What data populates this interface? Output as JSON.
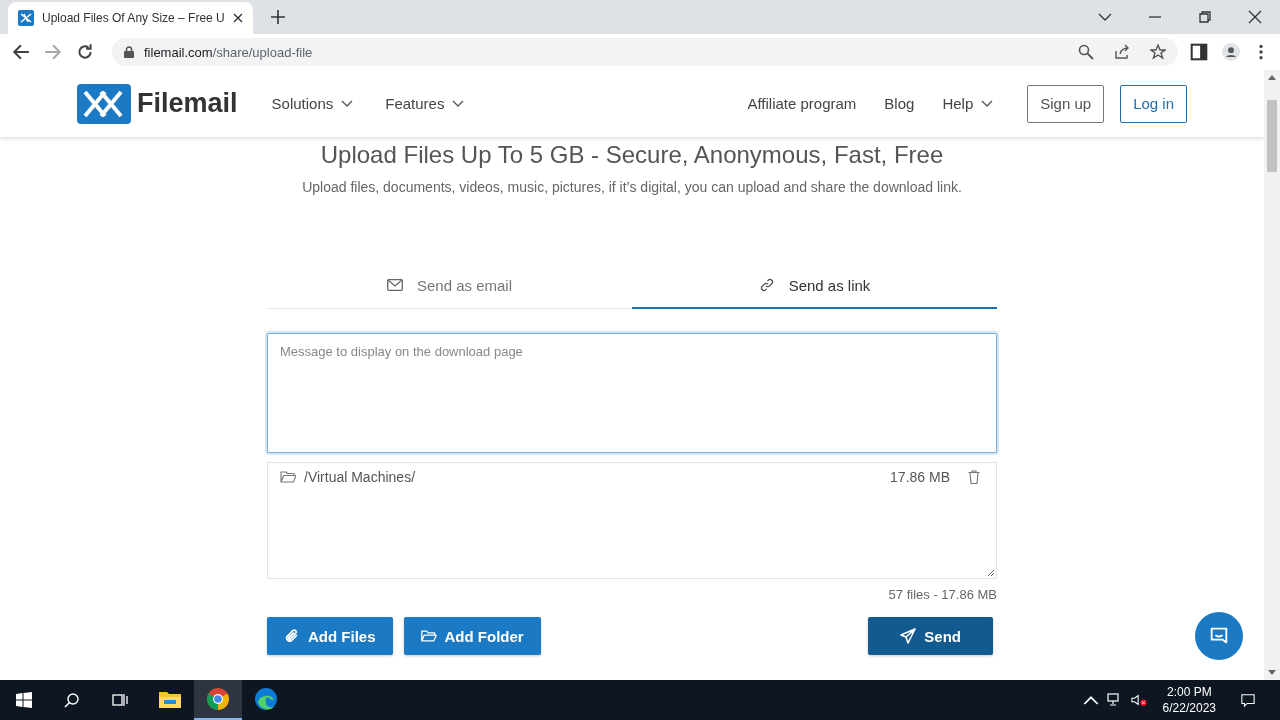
{
  "browser": {
    "tab_title": "Upload Files Of Any Size – Free U",
    "url_host": "filemail.com",
    "url_path": "/share/upload-file"
  },
  "nav": {
    "logo": "Filemail",
    "left_items": [
      {
        "label": "Solutions",
        "dropdown": true
      },
      {
        "label": "Features",
        "dropdown": true
      }
    ],
    "right_items": [
      {
        "label": "Affiliate program",
        "dropdown": false
      },
      {
        "label": "Blog",
        "dropdown": false
      },
      {
        "label": "Help",
        "dropdown": true
      }
    ],
    "buttons": [
      {
        "label": "Sign up",
        "kind": "outline"
      },
      {
        "label": "Log in",
        "kind": "primary-outline"
      }
    ]
  },
  "hero": {
    "heading": "Upload Files Up To 5 GB - Secure, Anonymous, Fast, Free",
    "subtitle": "Upload files, documents, videos, music, pictures, if it’s digital, you can upload and share the download link."
  },
  "tabs": [
    {
      "label": "Send as email",
      "kind": "email",
      "selected": false
    },
    {
      "label": "Send as link",
      "kind": "link",
      "selected": true
    }
  ],
  "message": {
    "placeholder": "Message to display on the download page"
  },
  "files": [
    {
      "name": "/Virtual Machines/",
      "size": "17.86 MB"
    }
  ],
  "summary": "57 files - 17.86 MB",
  "actions": [
    {
      "label": "Add Files",
      "kind": "files"
    },
    {
      "label": "Add Folder",
      "kind": "folder"
    }
  ],
  "send": {
    "label": "Send"
  },
  "taskbar": {
    "apps": [
      {
        "kind": "explorer",
        "selected": false
      },
      {
        "kind": "chrome",
        "selected": true
      },
      {
        "kind": "edge",
        "selected": false
      }
    ],
    "time": "2:00 PM",
    "date": "6/22/2023"
  }
}
